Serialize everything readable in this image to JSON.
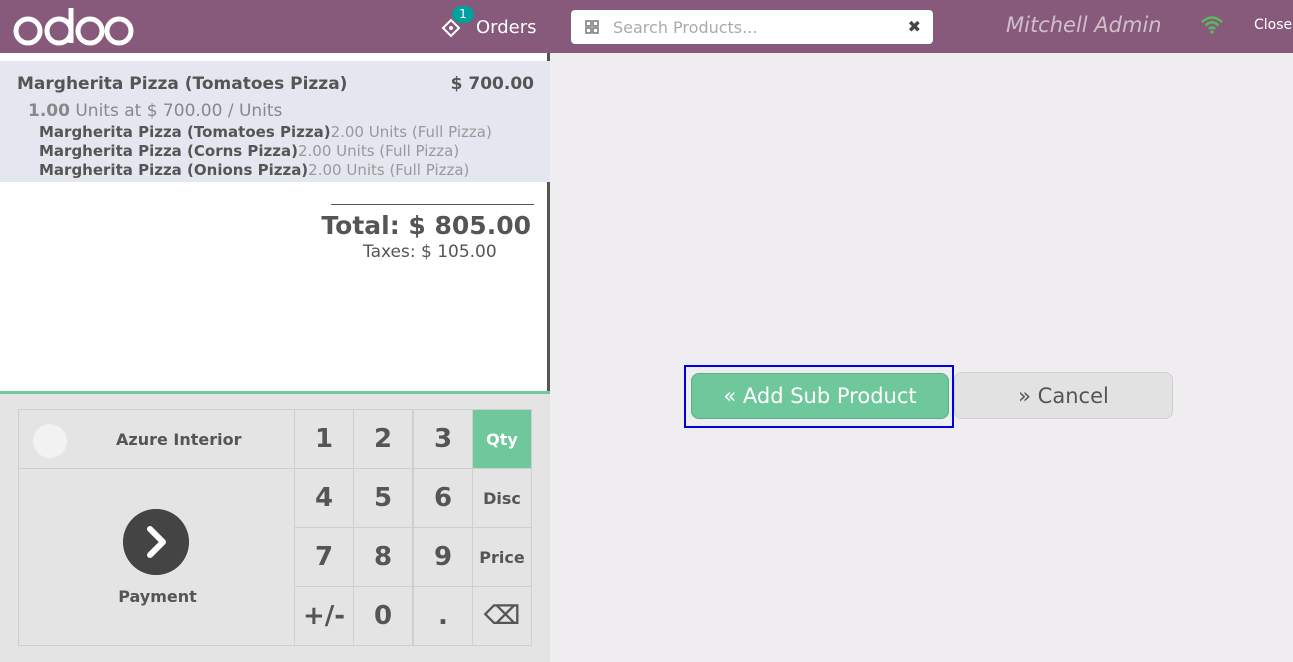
{
  "header": {
    "logo_text": "odoo",
    "orders_label": "Orders",
    "orders_badge": "1",
    "search_placeholder": "Search Products...",
    "clear_icon": "✖",
    "user_name": "Mitchell Admin",
    "close_label": "Close"
  },
  "order": {
    "line": {
      "name": "Margherita Pizza (Tomatoes Pizza)",
      "price": "$ 700.00",
      "qty": "1.00",
      "unit_text": "Units at $ 700.00 / Units",
      "sub_products": [
        {
          "name": "Margherita Pizza (Tomatoes Pizza)",
          "qty": "2.00 Units (Full Pizza)"
        },
        {
          "name": "Margherita Pizza (Corns Pizza)",
          "qty": "2.00 Units (Full Pizza)"
        },
        {
          "name": "Margherita Pizza (Onions Pizza)",
          "qty": "2.00 Units (Full Pizza)"
        }
      ]
    },
    "total": "Total: $ 805.00",
    "taxes": "Taxes: $ 105.00"
  },
  "pad": {
    "customer": "Azure Interior",
    "payment": "Payment",
    "keys": [
      "1",
      "2",
      "3",
      "Qty",
      "4",
      "5",
      "6",
      "Disc",
      "7",
      "8",
      "9",
      "Price",
      "+/-",
      "0",
      ".",
      "⌫"
    ]
  },
  "popup": {
    "add_label": "« Add Sub Product",
    "cancel_label": "» Cancel"
  },
  "colors": {
    "header": "#875a7b",
    "accent": "#6ec89b",
    "badge": "#00a09d",
    "focus_border": "#0000dd"
  }
}
